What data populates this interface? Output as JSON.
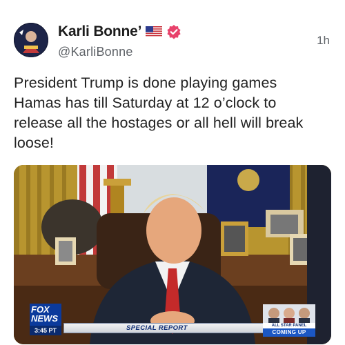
{
  "post": {
    "author": {
      "display_name": "Karli Bonne’",
      "handle": "@KarliBonne",
      "flag_icon": "us-flag-icon",
      "verified_icon": "verified-badge-icon",
      "verified_color": "#e8426b"
    },
    "time": "1h",
    "text_lines": [
      "President Trump is done playing games",
      "Hamas has till Saturday at 12 o’clock to",
      "release all the hostages or all hell will break",
      "loose!"
    ],
    "media": {
      "broadcast": {
        "network": "FOX",
        "network_sub": "NEWS",
        "time": "3:45 PT",
        "ticker_label": "SPECIAL REPORT",
        "panel_label": "ALL STAR PANEL",
        "coming_up": "COMING UP"
      }
    }
  }
}
